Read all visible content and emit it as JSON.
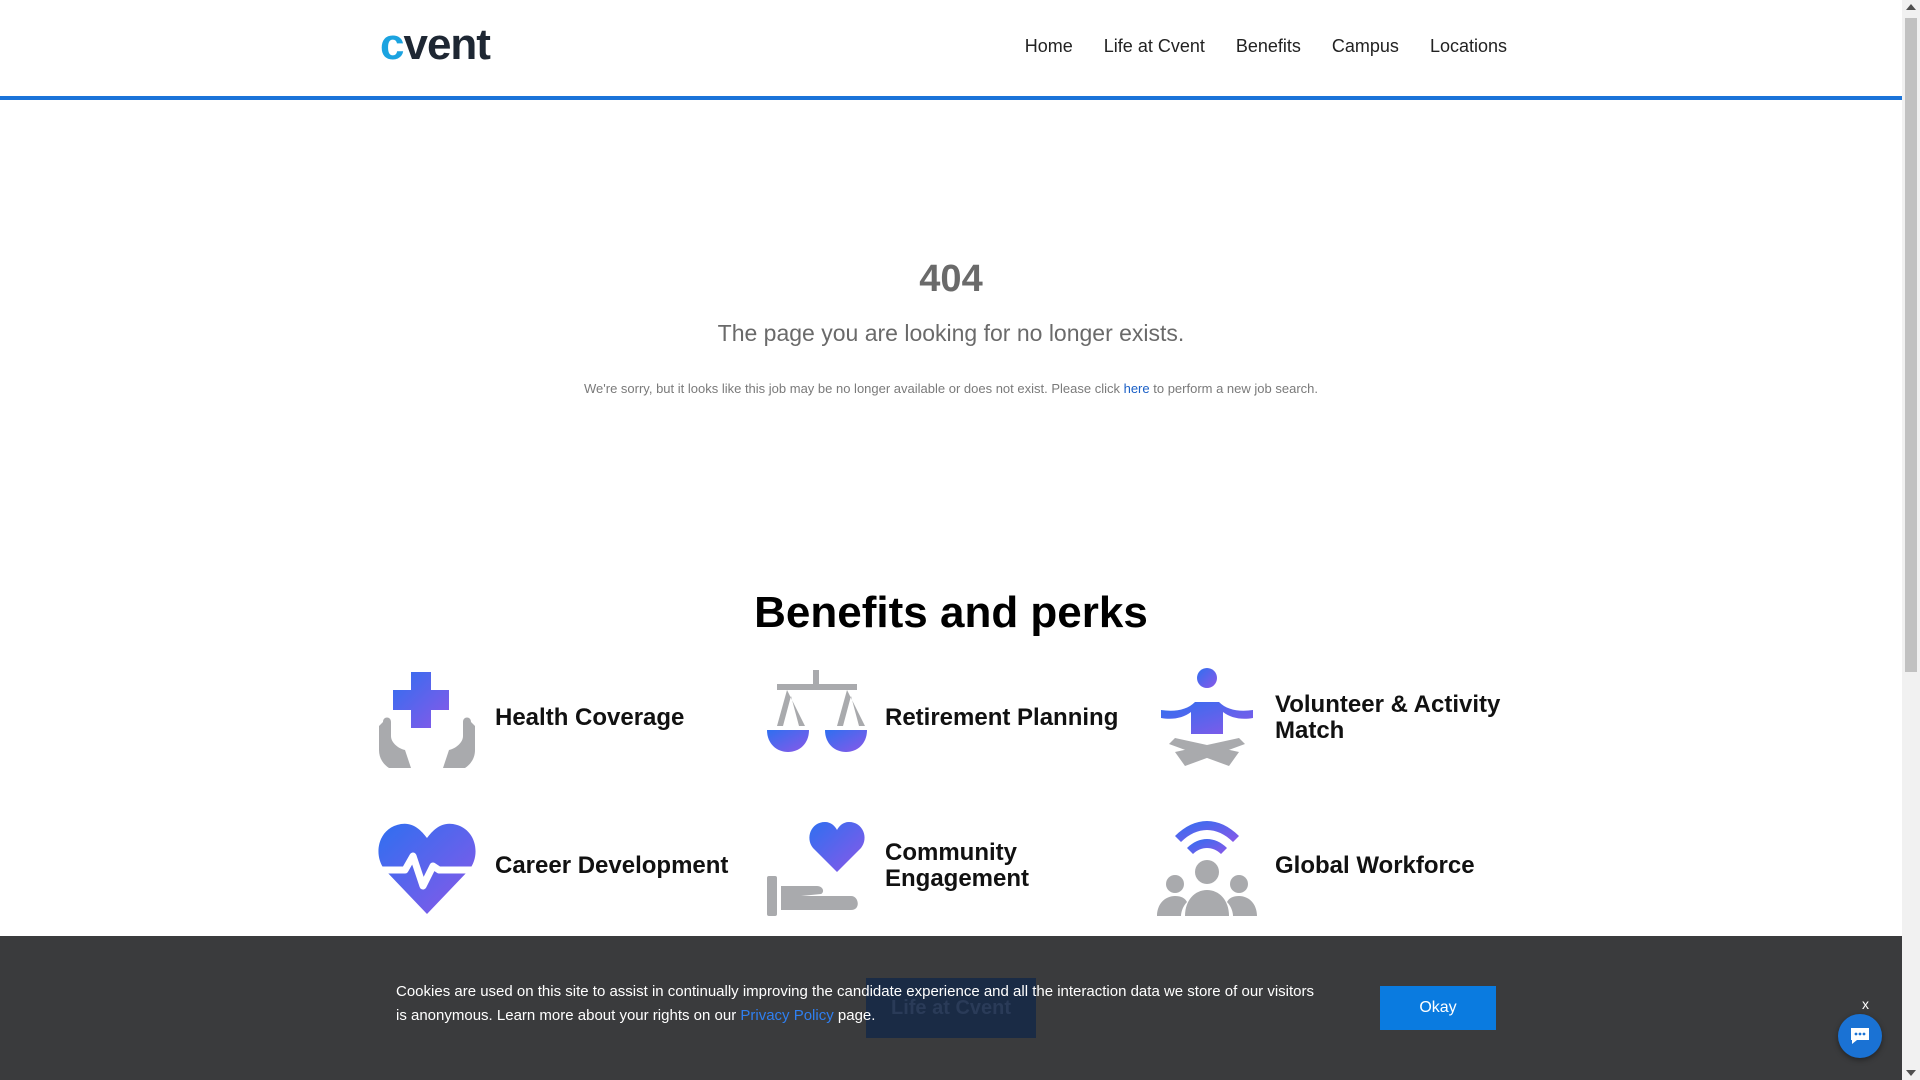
{
  "header": {
    "logo_c": "c",
    "logo_rest": "vent",
    "nav": [
      "Home",
      "Life at Cvent",
      "Benefits",
      "Campus",
      "Locations"
    ]
  },
  "error": {
    "code": "404",
    "title": "The page you are looking for no longer exists.",
    "message_before": "We're sorry, but it looks like this job may be no longer available or does not exist. Please click ",
    "link": "here",
    "message_after": " to perform a new job search."
  },
  "benefits": {
    "title": "Benefits and perks",
    "items": [
      {
        "label": "Health Coverage",
        "icon": "health-coverage-icon"
      },
      {
        "label": "Retirement Planning",
        "icon": "scales-icon"
      },
      {
        "label": "Volunteer & Activity Match",
        "icon": "meditation-icon"
      },
      {
        "label": "Career Development",
        "icon": "heartbeat-icon"
      },
      {
        "label": "Community Engagement",
        "icon": "heart-hand-icon"
      },
      {
        "label": "Global Workforce",
        "icon": "global-workforce-icon"
      }
    ]
  },
  "cookie": {
    "text_before": "Cookies are used on this site to assist in continually improving the candidate experience and all the interaction data we store of our visitors is anonymous. Learn more about your rights on our ",
    "link": "Privacy Policy",
    "text_after": " page.",
    "okay": "Okay",
    "close": "x",
    "behind_button": "Life at Cvent"
  },
  "colors": {
    "accent_blue": "#1a73d9",
    "logo_cyan": "#1ba3e0",
    "gradient_start": "#2f6ff0",
    "gradient_end": "#8a58e8",
    "icon_gray": "#a9aaad",
    "banner_bg": "#3a3b3d"
  }
}
